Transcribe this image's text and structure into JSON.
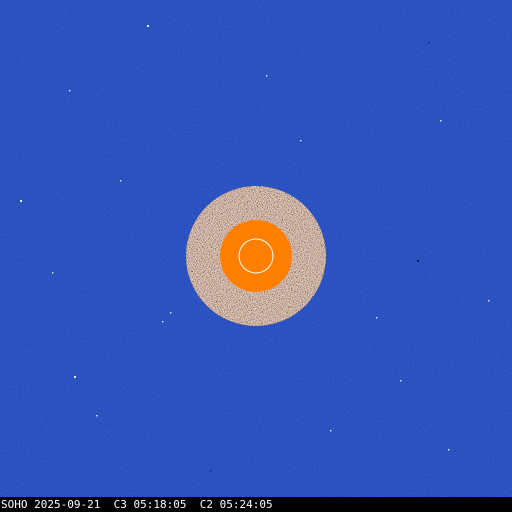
{
  "image": {
    "observatory_label": "SOHO",
    "date": "2025-09-21",
    "c3_label": "C3",
    "c3_time": "05:18:05",
    "c2_label": "C2",
    "c2_time": "05:24:05"
  },
  "colors": {
    "sky_background": "#1b45b9",
    "inner_disc_noise_dark": "#3a1c10",
    "inner_disc_noise_light": "#f2e6dc",
    "occulter_orange": "#ff7f00",
    "sun_outline": "#ffffff",
    "caption_text": "#ffffff",
    "caption_background": "#000000"
  }
}
